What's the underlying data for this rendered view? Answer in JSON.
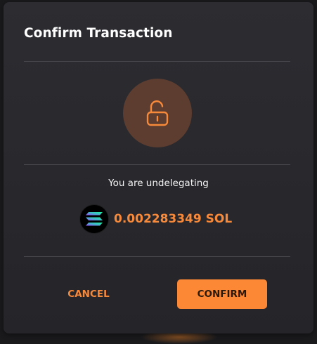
{
  "dialog": {
    "title": "Confirm Transaction",
    "status_icon": "unlock-icon",
    "message": "You are undelegating",
    "token_logo": "solana-logo-icon",
    "amount": "0.002283349 SOL",
    "cancel_label": "CANCEL",
    "confirm_label": "CONFIRM"
  },
  "colors": {
    "accent": "#fc8835",
    "amount_text": "#f7893b",
    "lock_circle_bg": "#5c3d30",
    "dialog_bg": "#2a2a2e",
    "divider": "#46464c"
  }
}
